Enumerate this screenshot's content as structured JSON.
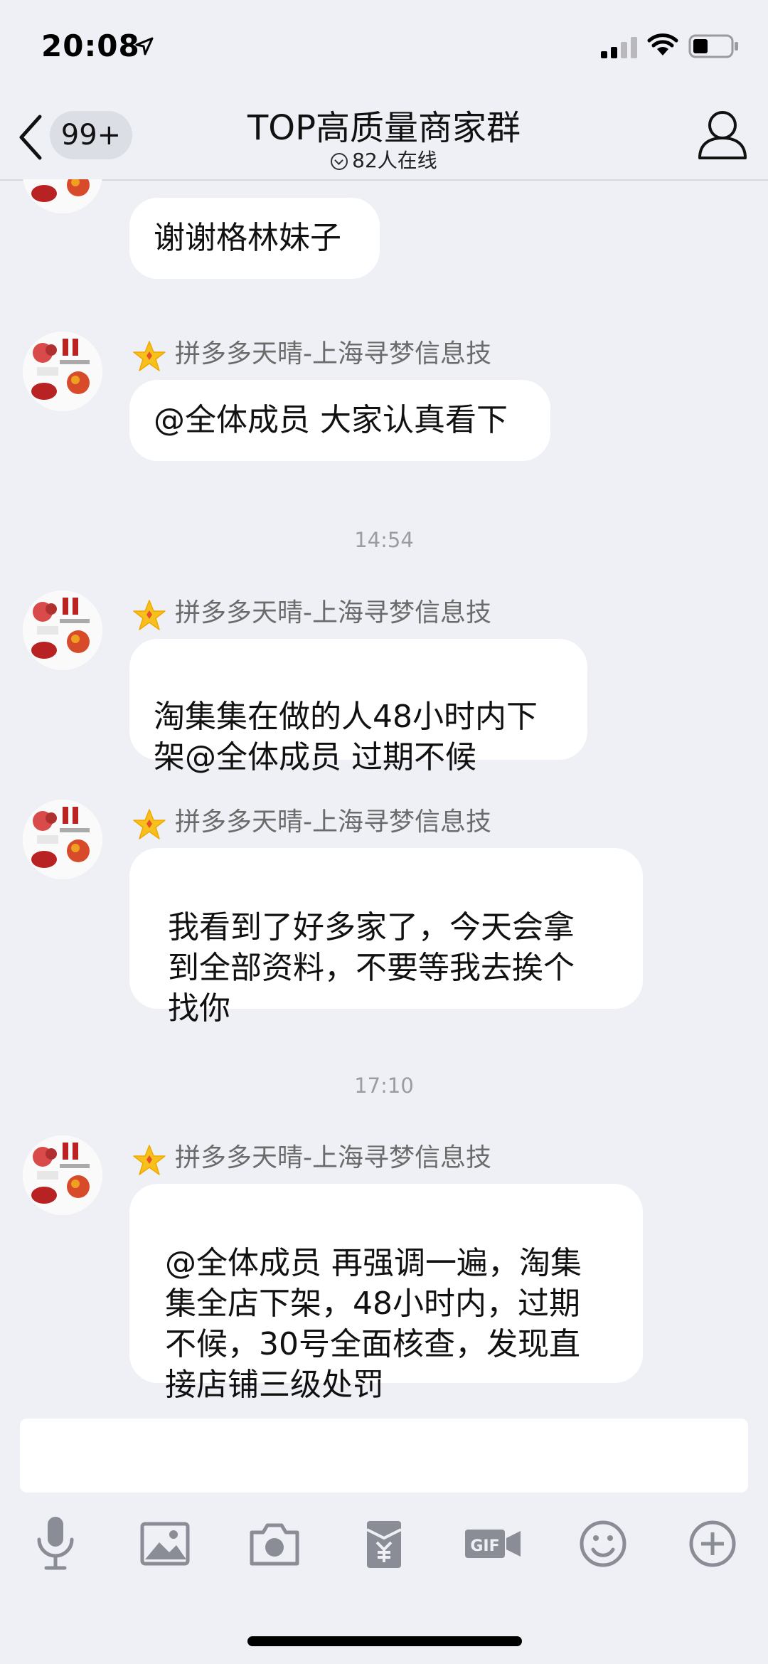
{
  "status_bar": {
    "time": "20:08"
  },
  "nav": {
    "unread_badge": "99+",
    "title": "TOP高质量商家群",
    "online": "82人在线"
  },
  "sender_name": "拼多多天晴-上海寻梦信息技",
  "messages": [
    {
      "text": "谢谢格林妹子"
    },
    {
      "text": "@全体成员 大家认真看下"
    },
    {
      "text": "淘集集在做的人48小时内下\n架@全体成员 过期不候"
    },
    {
      "text": "我看到了好多家了，今天会拿\n到全部资料，不要等我去挨个\n找你"
    },
    {
      "text": "@全体成员 再强调一遍，淘集\n集全店下架，48小时内，过期\n不候，30号全面核查，发现直\n接店铺三级处罚"
    }
  ],
  "timestamps": [
    "14:54",
    "17:10"
  ],
  "toolbar": [
    "microphone-icon",
    "image-icon",
    "camera-icon",
    "red-packet-icon",
    "gif-icon",
    "emoji-icon",
    "plus-icon"
  ],
  "colors": {
    "background": "#eef0f5",
    "bubble": "#ffffff",
    "star": "#f7c01c"
  }
}
